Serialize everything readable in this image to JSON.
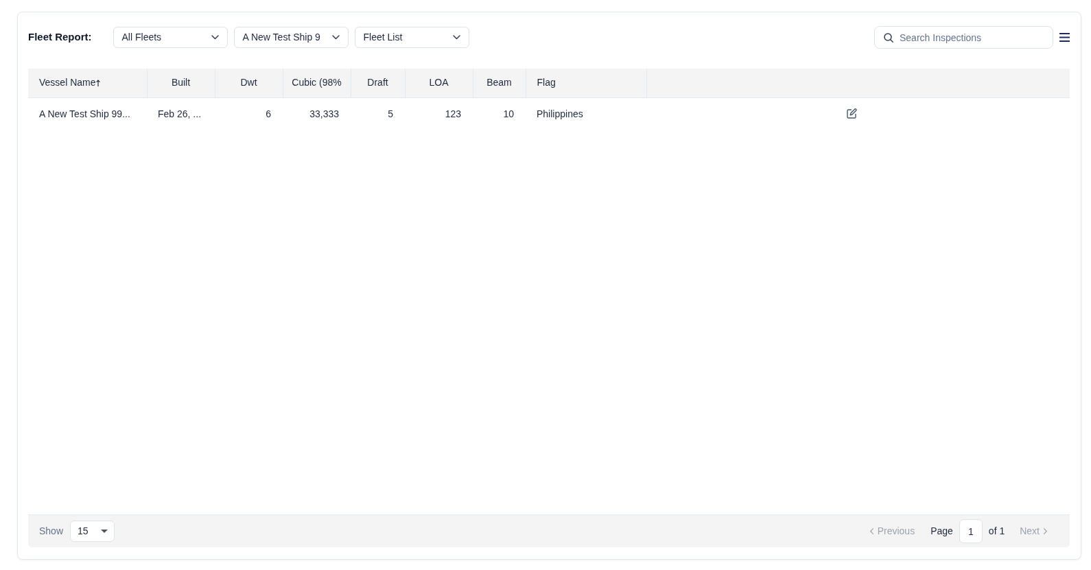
{
  "toolbar": {
    "title": "Fleet Report:",
    "filters": [
      {
        "value": "All Fleets"
      },
      {
        "value": "A New Test Ship 9"
      },
      {
        "value": "Fleet List"
      }
    ],
    "search": {
      "placeholder": "Search Inspections"
    }
  },
  "table": {
    "columns": [
      {
        "label": "Vessel Name",
        "kind": "text",
        "sorted": true
      },
      {
        "label": "Built",
        "kind": "date",
        "sorted": false
      },
      {
        "label": "Dwt",
        "kind": "number",
        "sorted": false
      },
      {
        "label": "Cubic (98%",
        "kind": "number",
        "sorted": false
      },
      {
        "label": "Draft",
        "kind": "number",
        "sorted": false
      },
      {
        "label": "LOA",
        "kind": "number",
        "sorted": false
      },
      {
        "label": "Beam",
        "kind": "number",
        "sorted": false
      },
      {
        "label": "Flag",
        "kind": "text",
        "sorted": false
      }
    ],
    "rows": [
      {
        "cells": [
          "A New Test Ship 99...",
          "Feb 26, ...",
          "6",
          "33,333",
          "5",
          "123",
          "10",
          "Philippines"
        ]
      }
    ]
  },
  "pagination": {
    "show_label": "Show",
    "page_size": "15",
    "previous": {
      "label": "Previous",
      "disabled": true
    },
    "page_label": "Page",
    "page": "1",
    "page_count": "of 1",
    "next": {
      "label": "Next",
      "disabled": true
    }
  }
}
